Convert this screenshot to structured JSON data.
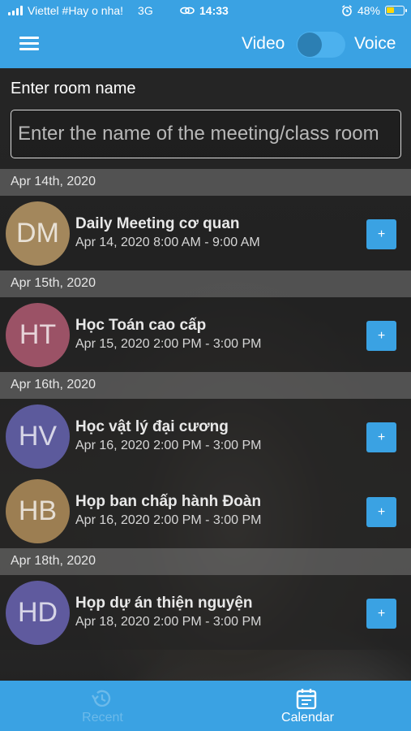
{
  "status_bar": {
    "carrier": "Viettel #Hay o nha!",
    "network": "3G",
    "time": "14:33",
    "battery_percent": "48%",
    "battery_level": 0.48
  },
  "header": {
    "menu_icon": "hamburger-menu-icon",
    "video_label": "Video",
    "voice_label": "Voice",
    "toggle_state": "video"
  },
  "room": {
    "label": "Enter room name",
    "placeholder": "Enter the name of the meeting/class room",
    "value": ""
  },
  "groups": [
    {
      "date": "Apr 14th, 2020",
      "events": [
        {
          "initials": "DM",
          "color": "#a3875c",
          "title": "Daily Meeting cơ quan",
          "time": "Apr 14, 2020 8:00 AM - 9:00 AM",
          "button": "+"
        }
      ]
    },
    {
      "date": "Apr 15th, 2020",
      "events": [
        {
          "initials": "HT",
          "color": "#9b5266",
          "title": "Học Toán cao cấp",
          "time": "Apr 15, 2020 2:00 PM - 3:00 PM",
          "button": "+"
        }
      ]
    },
    {
      "date": "Apr 16th, 2020",
      "events": [
        {
          "initials": "HV",
          "color": "#5c5a9c",
          "title": "Học vật lý đại cương",
          "time": "Apr 16, 2020 2:00 PM - 3:00 PM",
          "button": "+"
        },
        {
          "initials": "HB",
          "color": "#9c7e52",
          "title": "Họp ban chấp hành Đoàn",
          "time": "Apr 16, 2020 2:00 PM - 3:00 PM",
          "button": "+"
        }
      ]
    },
    {
      "date": "Apr 18th, 2020",
      "events": [
        {
          "initials": "HD",
          "color": "#5f5a9e",
          "title": "Họp dự án thiện nguyện",
          "time": "Apr 18, 2020 2:00 PM - 3:00 PM",
          "button": "+"
        }
      ]
    }
  ],
  "tabs": [
    {
      "label": "Recent",
      "icon": "history-icon",
      "active": false
    },
    {
      "label": "Calendar",
      "icon": "calendar-icon",
      "active": true
    }
  ],
  "colors": {
    "accent": "#3aa2e3",
    "inactive_tab": "#6cbaea"
  }
}
